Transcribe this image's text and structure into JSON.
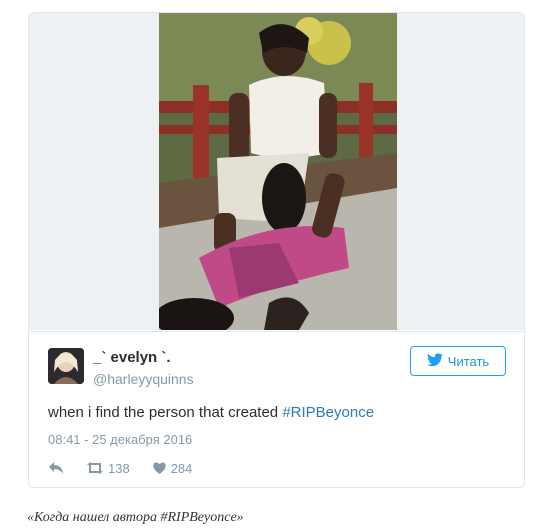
{
  "tweet": {
    "display_name": "_` evelyn `.",
    "handle": "@harleyyquinns",
    "follow_label": "Читать",
    "text_before": "when i find the person that created ",
    "hashtag": "#RIPBeyonce",
    "timestamp": "08:41 - 25 декабря 2016",
    "retweet_count": "138",
    "like_count": "284"
  },
  "icons": {
    "reply": "reply-icon",
    "retweet": "retweet-icon",
    "like": "heart-icon",
    "bird": "twitter-bird-icon"
  },
  "colors": {
    "accent": "#1da1f2",
    "hashtag": "#2b7bb9",
    "muted": "#8899a6",
    "text": "#292f33"
  },
  "caption": "«Когда нашел автора #RIPBeyonce»"
}
